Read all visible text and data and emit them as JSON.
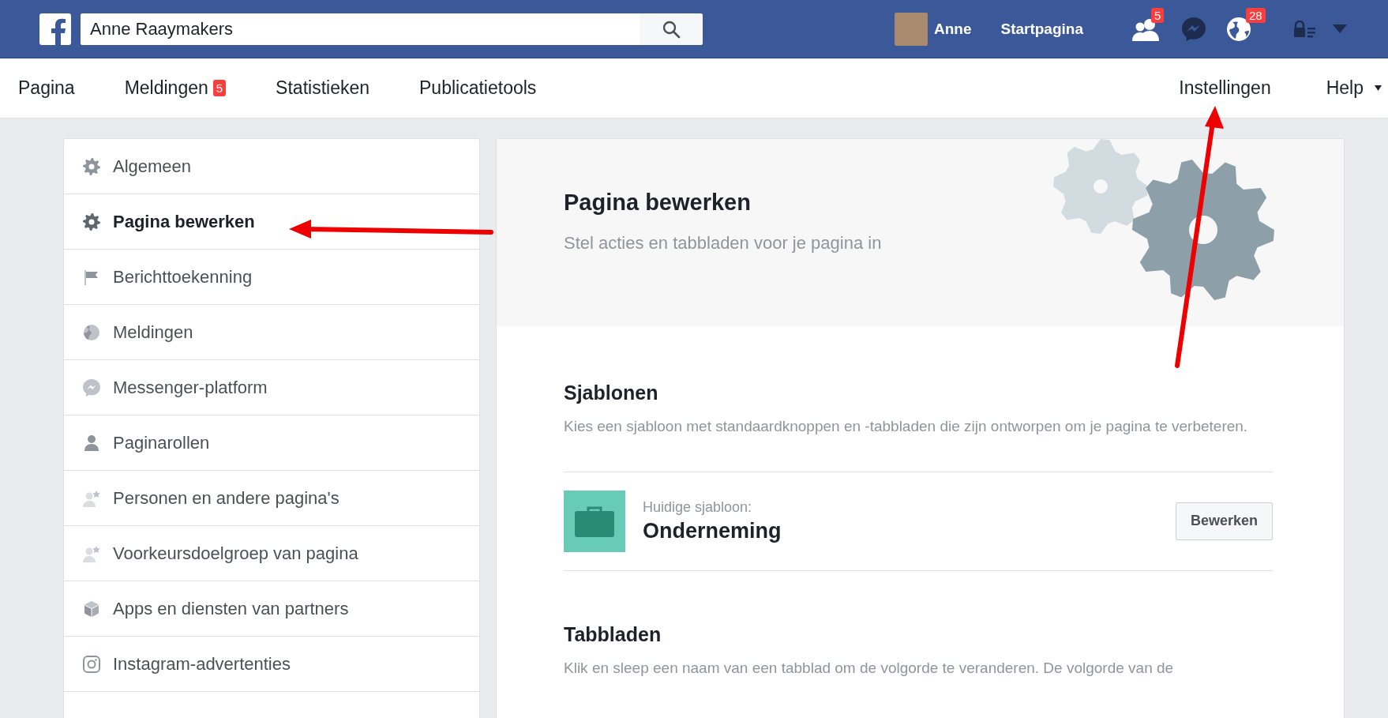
{
  "topbar": {
    "search": {
      "value": "Anne Raaymakers"
    },
    "profile_name": "Anne",
    "home_link": "Startpagina",
    "friend_requests_badge": "5",
    "notifications_badge": "28"
  },
  "nav": {
    "left": [
      {
        "label": "Pagina"
      },
      {
        "label": "Meldingen",
        "badge": "5"
      },
      {
        "label": "Statistieken"
      },
      {
        "label": "Publicatietools"
      }
    ],
    "right": [
      {
        "label": "Instellingen",
        "dropdown": false
      },
      {
        "label": "Help",
        "dropdown": true
      }
    ]
  },
  "sidebar": {
    "items": [
      {
        "label": "Algemeen",
        "kind": "gear",
        "selected": false
      },
      {
        "label": "Pagina bewerken",
        "kind": "gear",
        "selected": true
      },
      {
        "label": "Berichttoekenning",
        "kind": "flag",
        "selected": false
      },
      {
        "label": "Meldingen",
        "kind": "globe",
        "selected": false
      },
      {
        "label": "Messenger-platform",
        "kind": "messenger",
        "selected": false
      },
      {
        "label": "Paginarollen",
        "kind": "person",
        "selected": false
      },
      {
        "label": "Personen en andere pagina's",
        "kind": "person-star",
        "selected": false
      },
      {
        "label": "Voorkeursdoelgroep van pagina",
        "kind": "person-star",
        "selected": false
      },
      {
        "label": "Apps en diensten van partners",
        "kind": "cube",
        "selected": false
      },
      {
        "label": "Instagram-advertenties",
        "kind": "instagram",
        "selected": false
      }
    ]
  },
  "header": {
    "title": "Pagina bewerken",
    "subtitle": "Stel acties en tabbladen voor je pagina in"
  },
  "templates": {
    "heading": "Sjablonen",
    "description": "Kies een sjabloon met standaardknoppen en -tabbladen die zijn ontworpen om je pagina te verbeteren.",
    "current_label": "Huidige sjabloon:",
    "current_name": "Onderneming",
    "edit_button": "Bewerken"
  },
  "tabs_section": {
    "heading": "Tabbladen",
    "description": "Klik en sleep een naam van een tabblad om de volgorde te veranderen. De volgorde van de"
  }
}
